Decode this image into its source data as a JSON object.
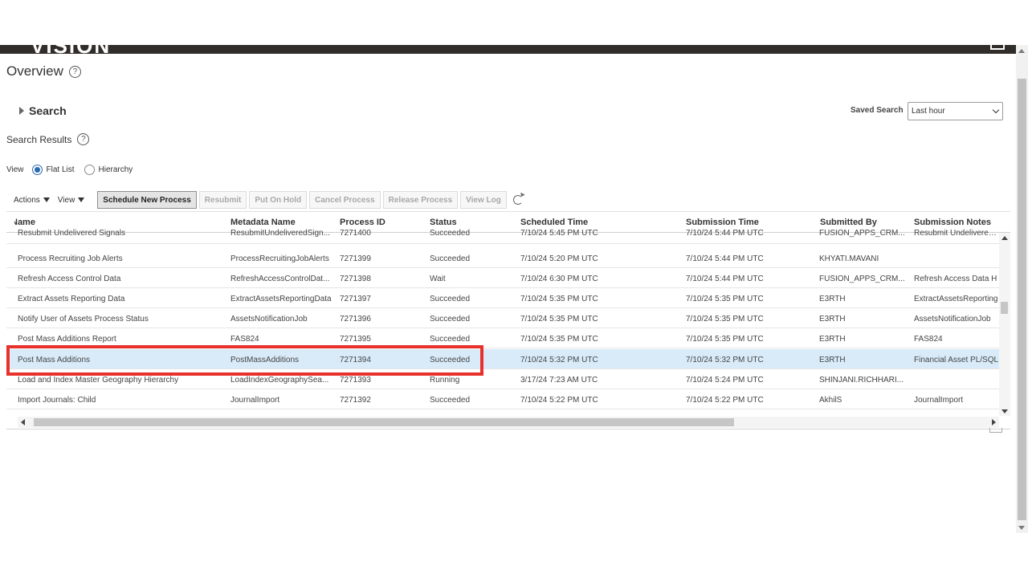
{
  "header": {
    "logo_text": "VISION"
  },
  "page": {
    "title": "Overview",
    "help_icon": "?"
  },
  "search": {
    "label": "Search",
    "saved_search_label": "Saved Search",
    "saved_search_value": "Last hour"
  },
  "results": {
    "title": "Search Results",
    "help_icon": "?"
  },
  "view": {
    "label": "View",
    "options": [
      "Flat List",
      "Hierarchy"
    ],
    "selected": "Flat List"
  },
  "toolbar": {
    "actions_label": "Actions",
    "view_label": "View",
    "schedule_label": "Schedule New Process",
    "resubmit_label": "Resubmit",
    "put_on_hold_label": "Put On Hold",
    "cancel_label": "Cancel Process",
    "release_label": "Release Process",
    "view_log_label": "View Log"
  },
  "table": {
    "columns": [
      "Name",
      "Metadata Name",
      "Process ID",
      "Status",
      "Scheduled Time",
      "Submission Time",
      "Submitted By",
      "Submission Notes"
    ],
    "rows": [
      [
        "Resubmit Undelivered Signals",
        "ResubmitUndeliveredSign...",
        "7271400",
        "Succeeded",
        "7/10/24 5:45 PM UTC",
        "7/10/24 5:44 PM UTC",
        "FUSION_APPS_CRM...",
        "Resubmit Undelivered S"
      ],
      [
        "Process Recruiting Job Alerts",
        "ProcessRecruitingJobAlerts",
        "7271399",
        "Succeeded",
        "7/10/24 5:20 PM UTC",
        "7/10/24 5:44 PM UTC",
        "KHYATI.MAVANI",
        ""
      ],
      [
        "Refresh Access Control Data",
        "RefreshAccessControlDat...",
        "7271398",
        "Wait",
        "7/10/24 6:30 PM UTC",
        "7/10/24 5:44 PM UTC",
        "FUSION_APPS_CRM...",
        "Refresh Access Data H"
      ],
      [
        "Extract Assets Reporting Data",
        "ExtractAssetsReportingData",
        "7271397",
        "Succeeded",
        "7/10/24 5:35 PM UTC",
        "7/10/24 5:35 PM UTC",
        "E3RTH",
        "ExtractAssetsReporting"
      ],
      [
        "Notify User of Assets Process Status",
        "AssetsNotificationJob",
        "7271396",
        "Succeeded",
        "7/10/24 5:35 PM UTC",
        "7/10/24 5:35 PM UTC",
        "E3RTH",
        "AssetsNotificationJob"
      ],
      [
        "Post Mass Additions Report",
        "FAS824",
        "7271395",
        "Succeeded",
        "7/10/24 5:35 PM UTC",
        "7/10/24 5:35 PM UTC",
        "E3RTH",
        "FAS824"
      ],
      [
        "Post Mass Additions",
        "PostMassAdditions",
        "7271394",
        "Succeeded",
        "7/10/24 5:32 PM UTC",
        "7/10/24 5:32 PM UTC",
        "E3RTH",
        "Financial Asset PL/SQL"
      ],
      [
        "Load and Index Master Geography Hierarchy",
        "LoadIndexGeographySea...",
        "7271393",
        "Running",
        "3/17/24 7:23 AM UTC",
        "7/10/24 5:24 PM UTC",
        "SHINJANI.RICHHARI...",
        ""
      ],
      [
        "Import Journals: Child",
        "JournalImport",
        "7271392",
        "Succeeded",
        "7/10/24 5:22 PM UTC",
        "7/10/24 5:22 PM UTC",
        "AkhilS",
        "JournalImport"
      ]
    ],
    "selected_row": 6
  },
  "colors": {
    "header_bg": "#312d2a",
    "selected_row": "#d9ebf9",
    "highlight": "#e8312b"
  }
}
